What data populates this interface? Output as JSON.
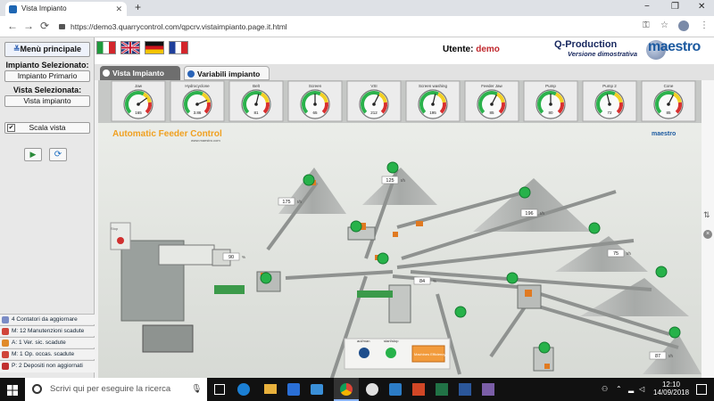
{
  "browser": {
    "tab_title": "Vista Impianto",
    "url": "https://demo3.quarrycontrol.com/qpcrv.vistaimpianto.page.it.html",
    "newtab": "+",
    "close": "✕",
    "back": "←",
    "forward": "→",
    "reload": "⟳",
    "min": "−",
    "max": "❐",
    "exit": "✕",
    "key": "⚿",
    "star": "☆",
    "menu": "⋮"
  },
  "left": {
    "menu_button": "Menù principale",
    "impianto_label": "Impianto Selezionato:",
    "impianto_value": "Impianto Primario",
    "vista_label": "Vista Selezionata:",
    "vista_value": "Vista impianto",
    "scala": "Scala vista",
    "check": "✔",
    "play": "▶",
    "refresh": "⟳"
  },
  "alerts": [
    {
      "text": "4 Contatori da aggiornare",
      "color": "#7b8cc6"
    },
    {
      "text": "M: 12 Manutenzioni scadute",
      "color": "#d0453a"
    },
    {
      "text": "A: 1 Ver. sic. scadute",
      "color": "#e08a2a"
    },
    {
      "text": "M: 1 Op. occas. scadute",
      "color": "#d0453a"
    },
    {
      "text": "P: 2 Depositi non aggiornati",
      "color": "#c13030"
    }
  ],
  "header": {
    "utente_label": "Utente:",
    "utente_value": "demo",
    "brand": "Q-Production",
    "brand_sub": "Versione dimostrativa",
    "brand_logo": "maestro"
  },
  "tabs": [
    {
      "label": "Vista Impianto"
    },
    {
      "label": "Variabili impianto"
    }
  ],
  "gauges": [
    {
      "label": "Jaw",
      "reading": "165",
      "fraction": 0.7
    },
    {
      "label": "Hydrocyclone",
      "reading": "3.86",
      "fraction": 0.75
    },
    {
      "label": "Belt",
      "reading": "81",
      "fraction": 0.55
    },
    {
      "label": "Screen",
      "reading": "65",
      "fraction": 0.5
    },
    {
      "label": "VSI",
      "reading": "212",
      "fraction": 0.6
    },
    {
      "label": "Screen washing",
      "reading": "195",
      "fraction": 0.55
    },
    {
      "label": "Feeder Jaw",
      "reading": "85",
      "fraction": 0.6
    },
    {
      "label": "Pump",
      "reading": "80",
      "fraction": 0.5
    },
    {
      "label": "Pump 2",
      "reading": "72",
      "fraction": 0.45
    },
    {
      "label": "Cone",
      "reading": "85",
      "fraction": 0.6
    }
  ],
  "scene": {
    "title": "Automatic Feeder Control",
    "site": "www.maestro.com",
    "logo": "maestro",
    "boxes": [
      {
        "value": "125",
        "unit": "t/h"
      },
      {
        "value": "175",
        "unit": "t/h"
      },
      {
        "value": "196",
        "unit": "t/h"
      },
      {
        "value": "75",
        "unit": "t/h"
      },
      {
        "value": "90",
        "unit": "%"
      },
      {
        "value": "84",
        "unit": "%"
      },
      {
        "value": "87",
        "unit": "t/h"
      }
    ],
    "controls": {
      "automan": "aut/man",
      "startstop": "start/stop",
      "machines": "Machines Efficiency"
    },
    "emergency": "Stop"
  },
  "taskbar": {
    "search": "Scrivi qui per eseguire la ricerca",
    "time": "12:10",
    "date": "14/09/2018",
    "mic": "🎙"
  }
}
